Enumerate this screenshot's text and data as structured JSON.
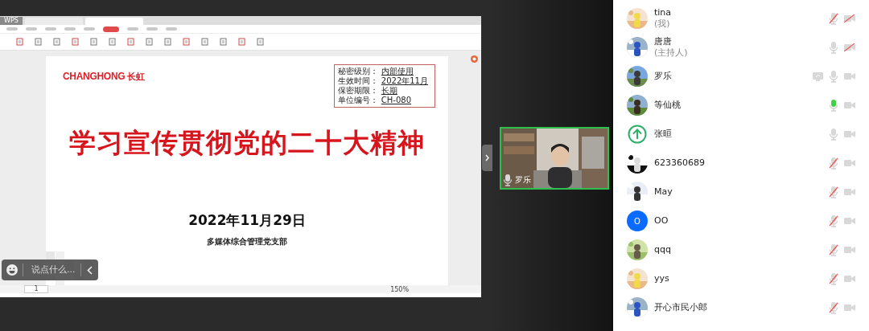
{
  "shared_screen": {
    "app_tab": "WPS",
    "menu_tabs": [
      {
        "selected": false
      },
      {
        "selected": false
      },
      {
        "selected": false
      },
      {
        "selected": false
      },
      {
        "selected": false
      },
      {
        "selected": true
      },
      {
        "selected": false
      },
      {
        "selected": false
      },
      {
        "selected": false
      }
    ],
    "document": {
      "logo_latin": "CHANGHONG",
      "logo_cjk": "长虹",
      "info": [
        {
          "label": "秘密级别：",
          "value": "内部使用"
        },
        {
          "label": "生效时间：",
          "value": "2022年11月"
        },
        {
          "label": "保密期限：",
          "value": "长期"
        },
        {
          "label": "单位编号：",
          "value": "CH-080"
        }
      ],
      "title": "学习宣传贯彻党的二十大精神",
      "date": "2022年11月29日",
      "organization": "多媒体综合管理党支部"
    },
    "status_bar": {
      "page": "1",
      "zoom": "150%"
    }
  },
  "chat_bar": {
    "placeholder": "说点什么..."
  },
  "video_tile": {
    "name": "罗乐"
  },
  "participants": [
    {
      "name": "tina",
      "role": "(我)",
      "muted": true,
      "speaking": false,
      "camera_off": true,
      "sharing": false
    },
    {
      "name": "唐唐",
      "role": "(主持人)",
      "muted": false,
      "speaking": false,
      "camera_off": true,
      "sharing": false
    },
    {
      "name": "罗乐",
      "muted": false,
      "speaking": false,
      "camera_off": false,
      "sharing": true
    },
    {
      "name": "等仙桃",
      "muted": false,
      "speaking": true,
      "camera_off": false,
      "sharing": false
    },
    {
      "name": "张晅",
      "avatar": {
        "kind": "icon"
      },
      "muted": false,
      "speaking": false,
      "camera_off": false,
      "sharing": false
    },
    {
      "name": "623360689",
      "muted": true,
      "speaking": false,
      "camera_off": false,
      "sharing": false
    },
    {
      "name": "May",
      "muted": true,
      "speaking": false,
      "camera_off": false,
      "sharing": false
    },
    {
      "name": "OO",
      "avatar": {
        "kind": "letter",
        "letter": "O"
      },
      "muted": true,
      "speaking": false,
      "camera_off": false,
      "sharing": false
    },
    {
      "name": "qqq",
      "muted": true,
      "speaking": false,
      "camera_off": false,
      "sharing": false
    },
    {
      "name": "yys",
      "muted": true,
      "speaking": false,
      "camera_off": false,
      "sharing": false
    },
    {
      "name": "开心市民小郎",
      "muted": true,
      "speaking": false,
      "camera_off": false,
      "sharing": false
    }
  ]
}
